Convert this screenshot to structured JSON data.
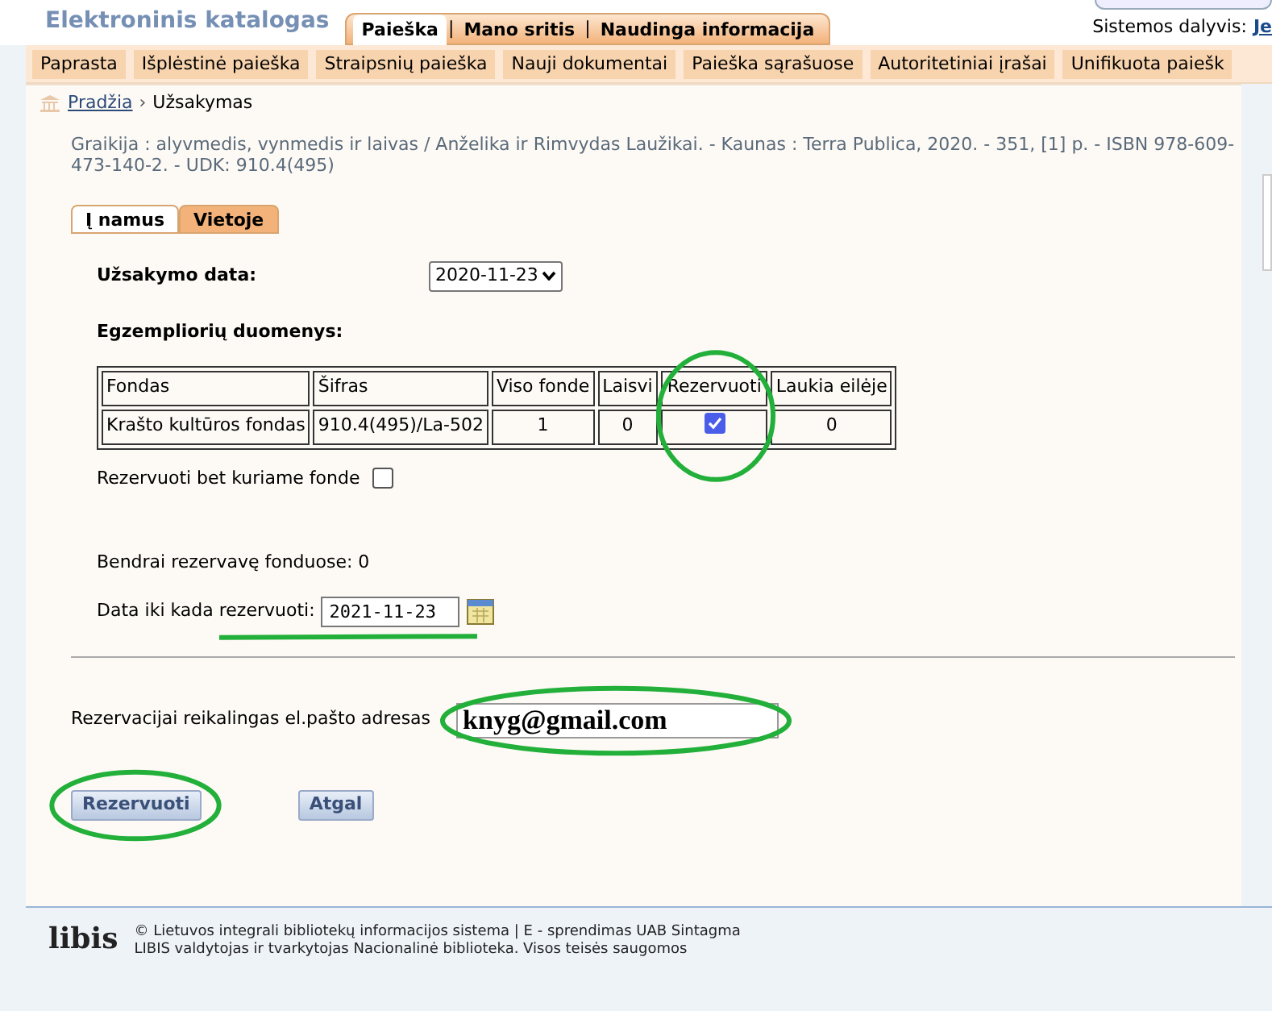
{
  "header": {
    "title": "Elektroninis katalogas",
    "tabs": [
      {
        "label": "Paieška",
        "selected": true
      },
      {
        "label": "Mano sritis",
        "selected": false
      },
      {
        "label": "Naudinga informacija",
        "selected": false
      }
    ],
    "separator": "|",
    "user_label": "Sistemos dalyvis:",
    "user_link": "Je"
  },
  "subnav": [
    "Paprasta",
    "Išplėstinė paieška",
    "Straipsnių paieška",
    "Nauji dokumentai",
    "Paieška sąrašuose",
    "Autoritetiniai įrašai",
    "Unifikuota paiešk"
  ],
  "breadcrumb": {
    "home": "Pradžia",
    "separator": "›",
    "current": "Užsakymas"
  },
  "record": "Graikija : alyvmedis, vynmedis ir laivas / Anželika ir Rimvydas Laužikai. - Kaunas : Terra Publica, 2020. - 351, [1] p. - ISBN 978-609-473-140-2. - UDK: 910.4(495)",
  "order_tabs": [
    {
      "label": "Į namus",
      "selected": true
    },
    {
      "label": "Vietoje",
      "selected": false
    }
  ],
  "order_date": {
    "label": "Užsakymo data:",
    "value": "2020-11-23"
  },
  "copies": {
    "title": "Egzempliorių duomenys:",
    "columns": [
      "Fondas",
      "Šifras",
      "Viso fonde",
      "Laisvi",
      "Rezervuoti",
      "Laukia eilėje"
    ],
    "rows": [
      {
        "fund": "Krašto kultūros fondas",
        "code": "910.4(495)/La-502",
        "total": "1",
        "free": "0",
        "reserved": true,
        "queue": "0"
      }
    ]
  },
  "any_fund": {
    "label": "Rezervuoti bet kuriame fonde",
    "checked": false
  },
  "total": "Bendrai rezervavę fonduose: 0",
  "until": {
    "label": "Data iki kada rezervuoti:",
    "value": "2021-11-23"
  },
  "email": {
    "label": "Rezervacijai reikalingas el.pašto adresas",
    "value": "knyg@gmail.com"
  },
  "buttons": [
    "Rezervuoti",
    "Atgal"
  ],
  "footer": {
    "logo": "libis",
    "lines": [
      "© Lietuvos integrali bibliotekų informacijos sistema | E - sprendimas UAB Sintagma",
      "LIBIS valdytojas ir tvarkytojas Nacionalinė biblioteka. Visos teisės saugomos"
    ]
  }
}
